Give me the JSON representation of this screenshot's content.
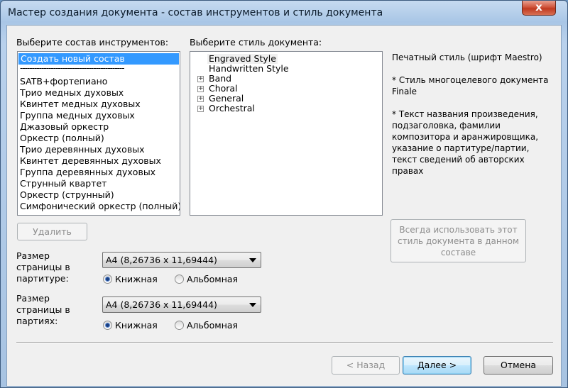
{
  "window": {
    "title": "Мастер создания документа - состав инструментов и стиль документа",
    "close_glyph": "x"
  },
  "instruments": {
    "label": "Выберите состав инструментов:",
    "items": [
      "Создать новый состав",
      "--------------------------------------------",
      "SATB+фортепиано",
      "Трио медных духовых",
      "Квинтет медных духовых",
      "Группа медных духовых",
      "Джазовый оркестр",
      "Оркестр (полный)",
      "Трио деревянных духовых",
      "Квинтет деревянных духовых",
      "Группа деревянных духовых",
      "Струнный квартет",
      "Оркестр (струнный)",
      "Симфонический оркестр (полный)"
    ]
  },
  "style": {
    "label": "Выберите стиль документа:",
    "items": [
      {
        "label": "Engraved Style",
        "expandable": false
      },
      {
        "label": "Handwritten Style",
        "expandable": false
      },
      {
        "label": "Band",
        "expandable": true
      },
      {
        "label": "Choral",
        "expandable": true
      },
      {
        "label": "General",
        "expandable": true
      },
      {
        "label": "Orchestral",
        "expandable": true
      }
    ]
  },
  "description": {
    "line1": "Печатный стиль (шрифт Maestro)",
    "line2": "* Стиль многоцелевого документа Finale",
    "line3": "* Текст названия произведения, подзаголовка, фамилии композитора и аранжировщика, указание о партитуре/партии, текст сведений об авторских правах"
  },
  "buttons": {
    "delete": "Удалить",
    "always_use": "Всегда использовать этот стиль документа в данном составе",
    "back": "< Назад",
    "next": "Далее >",
    "cancel": "Отмена"
  },
  "score_page": {
    "label": "Размер страницы в партитуре:",
    "size": "A4 (8,26736 x 11,69444)",
    "portrait": "Книжная",
    "landscape": "Альбомная",
    "orientation": "portrait"
  },
  "parts_page": {
    "label": "Размер страницы в партиях:",
    "size": "A4 (8,26736 x 11,69444)",
    "portrait": "Книжная",
    "landscape": "Альбомная",
    "orientation": "portrait"
  }
}
